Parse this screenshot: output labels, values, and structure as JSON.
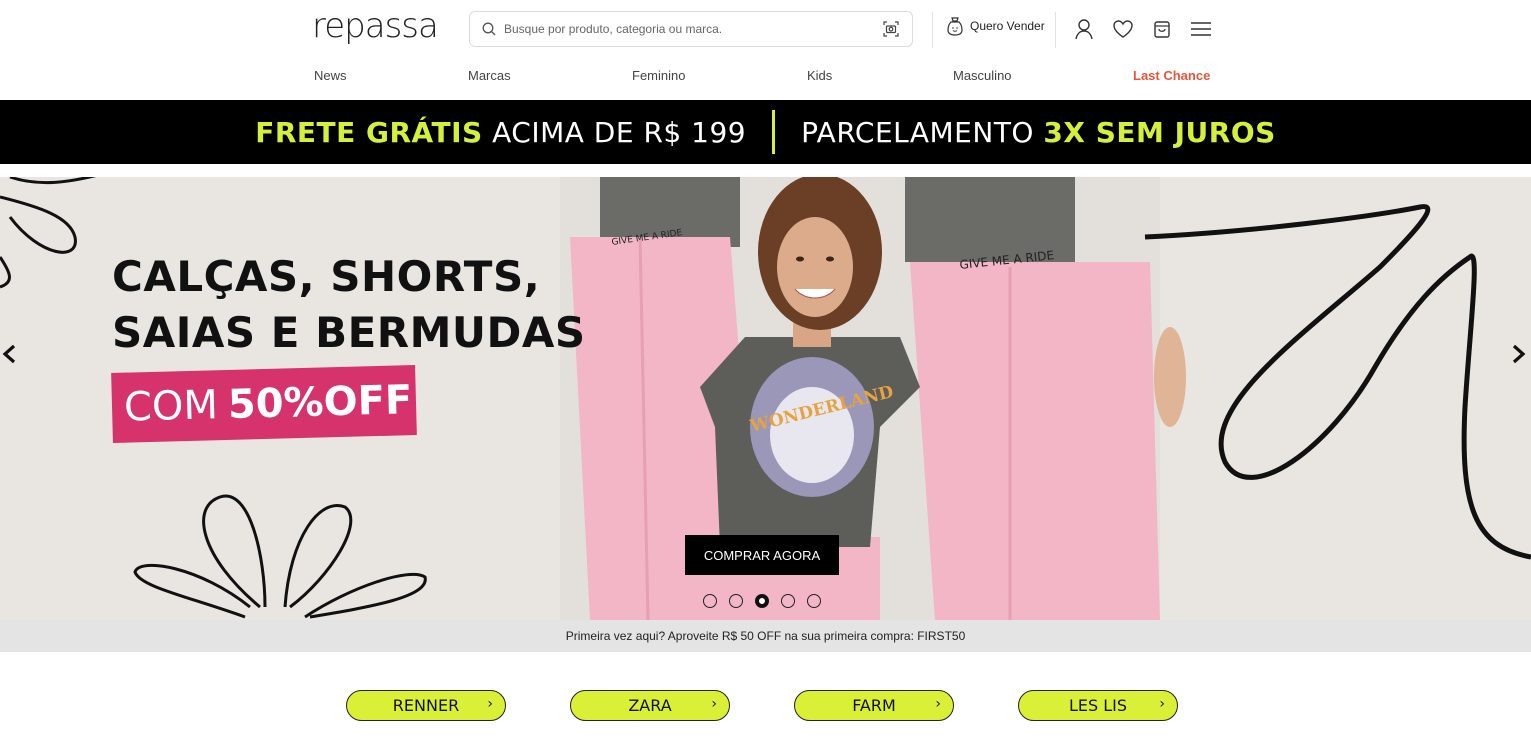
{
  "header": {
    "logo": "repassa",
    "search_placeholder": "Busque por produto, categoria ou marca.",
    "sell_label": "Quero Vender"
  },
  "nav": {
    "items": [
      {
        "label": "News"
      },
      {
        "label": "Marcas"
      },
      {
        "label": "Feminino"
      },
      {
        "label": "Kids"
      },
      {
        "label": "Masculino"
      },
      {
        "label": "Last Chance"
      }
    ]
  },
  "promo": {
    "part1_highlight": "FRETE GRÁTIS",
    "part1_rest": "ACIMA DE R$ 199",
    "part2_rest": "PARCELAMENTO",
    "part2_highlight": "3X SEM JUROS"
  },
  "hero": {
    "title_line1": "CALÇAS, SHORTS,",
    "title_line2": "SAIAS E BERMUDAS",
    "badge_prefix": "COM",
    "badge_value": "50%OFF",
    "shirt_text_1": "GIVE ME A RIDE",
    "shirt_text_2": "WONDERLAND",
    "cta_label": "COMPRAR AGORA",
    "slide_count": 5,
    "active_slide": 3
  },
  "first_purchase": {
    "text": "Primeira vez aqui? Aproveite R$ 50 OFF na sua primeira compra: FIRST50"
  },
  "brands": [
    {
      "label": "RENNER"
    },
    {
      "label": "ZARA"
    },
    {
      "label": "FARM"
    },
    {
      "label": "LES LIS"
    }
  ],
  "colors": {
    "accent_lime": "#d6f03a",
    "badge_pink": "#d6336c",
    "last_chance": "#e8553a"
  }
}
